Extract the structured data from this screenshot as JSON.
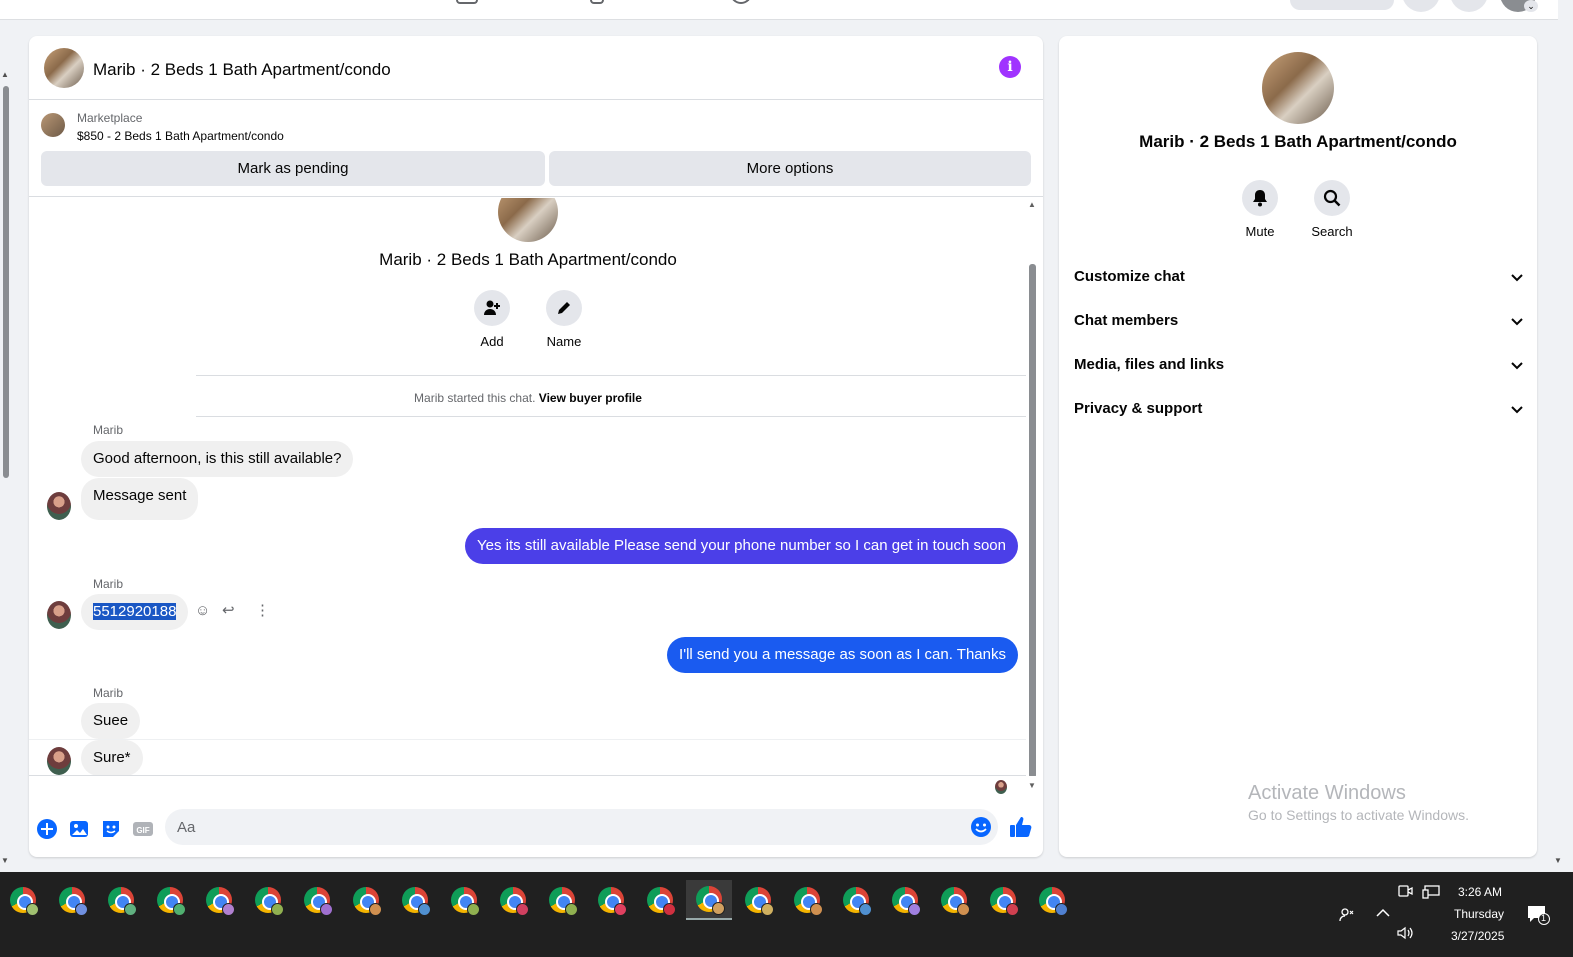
{
  "conversation": {
    "title": "Marib · 2 Beds 1 Bath Apartment/condo",
    "marketplace_label": "Marketplace",
    "listing": "$850 - 2 Beds 1 Bath Apartment/condo",
    "mark_pending": "Mark as pending",
    "more_options": "More options"
  },
  "intro": {
    "name": "Marib · 2 Beds 1 Bath Apartment/condo",
    "add_label": "Add",
    "name_label": "Name",
    "started_text": "Marib started this chat.",
    "view_profile": "View buyer profile"
  },
  "messages": [
    {
      "sender": "Marib",
      "text": "Good afternoon, is this still available?"
    },
    {
      "text": "Message sent"
    },
    {
      "text": "Yes its still available Please send your phone number so I can get in touch soon"
    },
    {
      "sender": "Marib",
      "text": "5512920188"
    },
    {
      "text": "I'll send you a message as soon as I can. Thanks"
    },
    {
      "sender": "Marib",
      "text": "Suee"
    },
    {
      "text": "Sure*"
    }
  ],
  "composer": {
    "placeholder": "Aa",
    "gif_label": "GIF"
  },
  "info_panel": {
    "name": "Marib · 2 Beds 1 Bath Apartment/condo",
    "mute": "Mute",
    "search": "Search",
    "sections": [
      "Customize chat",
      "Chat members",
      "Media, files and links",
      "Privacy & support"
    ]
  },
  "watermark": {
    "line1": "Activate Windows",
    "line2": "Go to Settings to activate Windows."
  },
  "taskbar": {
    "time": "3:26 AM",
    "day": "Thursday",
    "date": "3/27/2025",
    "notification_count": "1",
    "badge_colors": [
      "#a0c070",
      "#7090e0",
      "#60b080",
      "#50b070",
      "#b080d0",
      "#90b050",
      "#a070d0",
      "#d09050",
      "#5090d0",
      "#90b050",
      "#d04060",
      "#90b050",
      "#e04060",
      "#d03040",
      "#d0a060",
      "#d0b060",
      "#d09050",
      "#5090d0",
      "#a080e0",
      "#d09050",
      "#d04050",
      "#5080d0"
    ]
  },
  "colors": {
    "outgoing_purple": "#4b3fe8",
    "outgoing_blue": "#1a5bf0",
    "accent": "#0866ff",
    "info_purple": "#a033ff"
  }
}
